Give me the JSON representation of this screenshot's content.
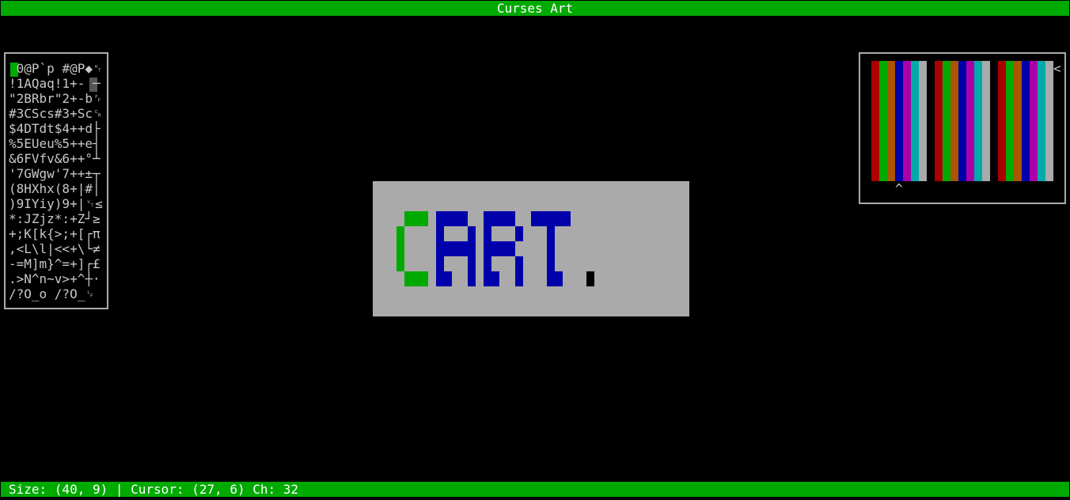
{
  "window": {
    "title": "Curses Art"
  },
  "status": {
    "text": "Size: (40, 9) | Cursor: (27, 6) Ch: 32"
  },
  "charmap": {
    "rows": [
      " 0@P`p #@P◆␉",
      "!1AQaq!1+- ─",
      "\"2BRbr\"2+-b␌",
      "#3CScs#3+Sc␍",
      "$4DTdt$4++d├",
      "%5EUeu%5++e┤",
      "&6FVfv&6++°┴",
      "'7GWgw'7++±┬",
      "(8HXhx(8+|#│",
      ")9IYiy)9+|␋≤",
      "*:JZjz*:+Z┘≥",
      "+;K[k{>;+[┌π",
      ",<L\\l|<<+\\└≠",
      "-=M]m}^=+]┌£",
      ".>N^n~v>+^┼·",
      "/?O_o /?O_␊"
    ]
  },
  "palette": {
    "colors": [
      "#aa0000",
      "#00aa00",
      "#aa5500",
      "#0000aa",
      "#aa00aa",
      "#00aaaa",
      "#aaaaaa"
    ],
    "arrow_right": "<",
    "arrow_up": "^"
  },
  "canvas": {
    "fg_letter_c": "#00aa00",
    "fg_letters": "#0000aa",
    "background": "#aaaaaa"
  }
}
